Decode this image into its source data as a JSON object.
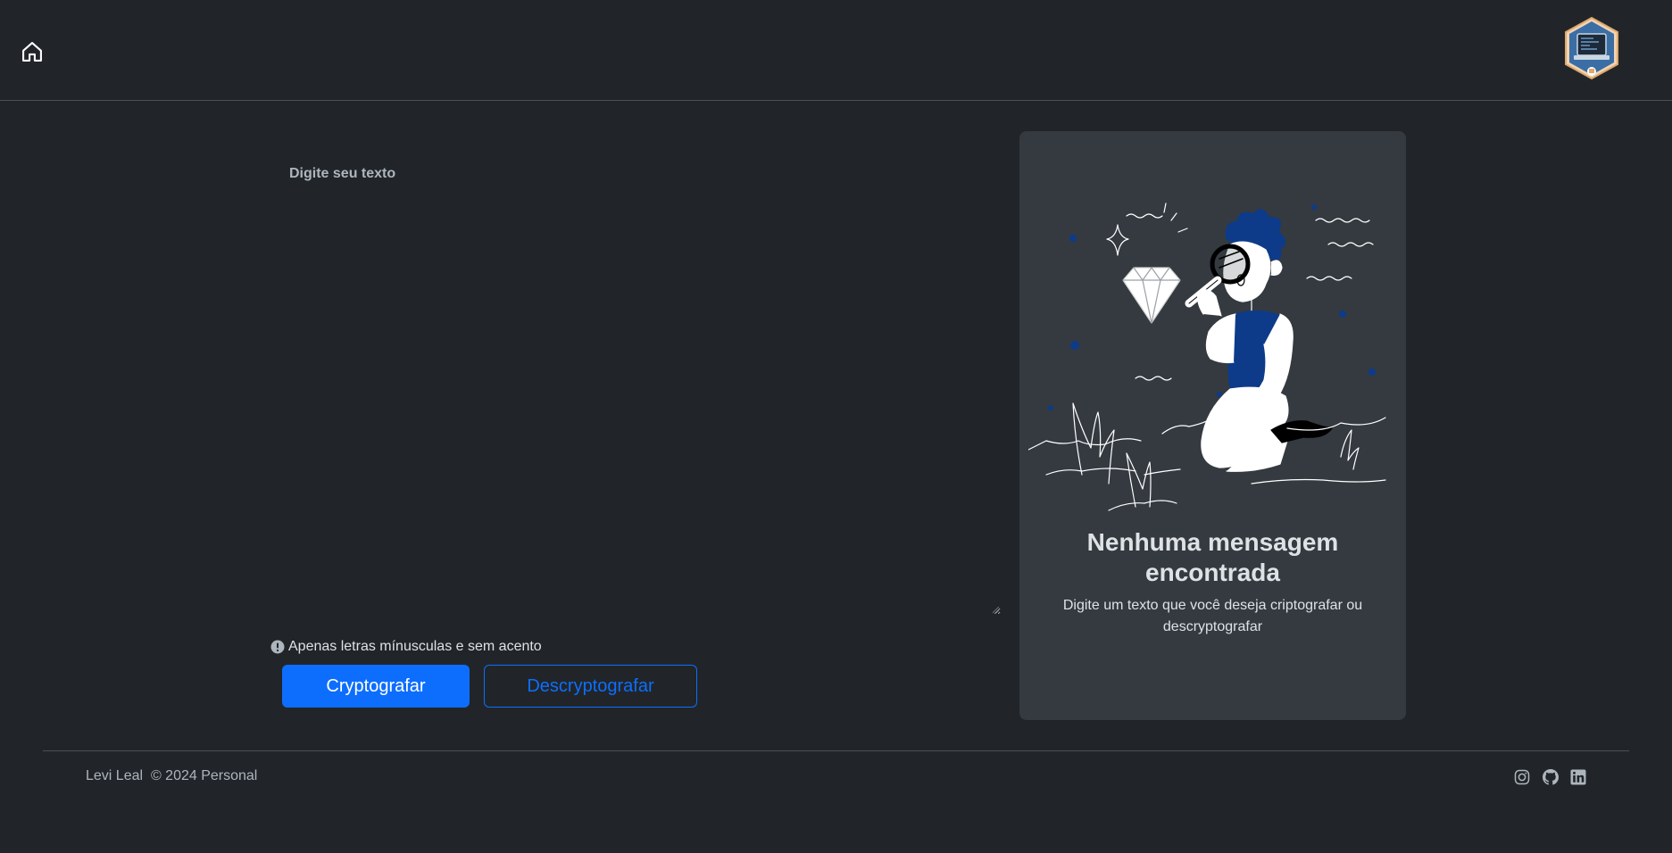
{
  "header": {
    "home_icon": "house-icon",
    "logo_icon": "developer-logo-icon"
  },
  "input": {
    "label": "Digite seu texto",
    "value": "",
    "placeholder": ""
  },
  "hint": {
    "icon": "info-circle-icon",
    "text": "Apenas letras mínusculas e sem acento"
  },
  "buttons": {
    "encrypt_label": "Cryptografar",
    "decrypt_label": "Descryptografar"
  },
  "output": {
    "illustration": "person-with-magnifying-glass-illustration",
    "title": "Nenhuma mensagem encontrada",
    "subtitle": "Digite um texto que você deseja criptografar ou descryptografar"
  },
  "footer": {
    "author": "Levi Leal",
    "copyright": "© 2024 Personal",
    "social": [
      "instagram-icon",
      "github-icon",
      "linkedin-icon"
    ]
  },
  "colors": {
    "background": "#212529",
    "card": "#343a40",
    "primary": "#0d6efd",
    "illustration_accent": "#0d3b8a"
  }
}
